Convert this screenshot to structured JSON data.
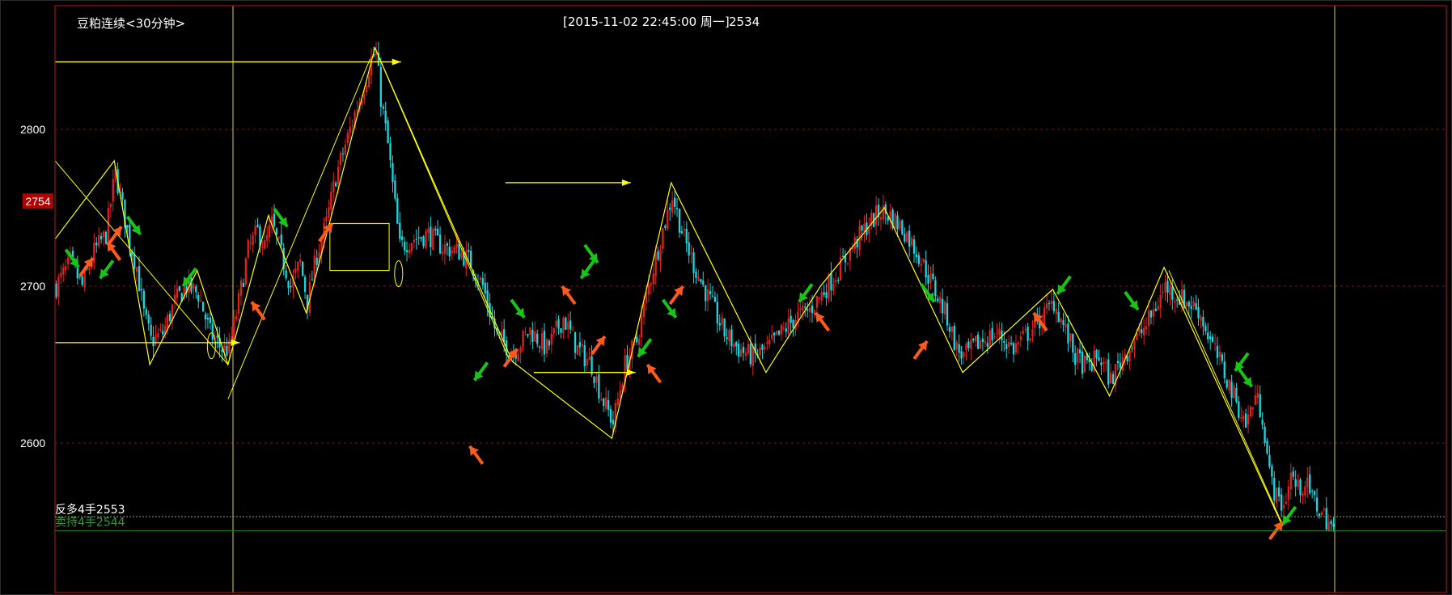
{
  "header": {
    "title": "豆粕连续<30分钟>",
    "timestamp": "[2015-11-02  22:45:00 周一]",
    "price": "2534"
  },
  "cursor_price_label": "2754",
  "positions": [
    {
      "label": "反多4手2553",
      "price": 2553,
      "color": "#ffffff"
    },
    {
      "label": "卖持4手2544",
      "price": 2544,
      "color": "#2e9e2e"
    }
  ],
  "colors": {
    "background": "#000000",
    "frame": "#a01010",
    "grid": "#7a1515",
    "up_candle": "#e02020",
    "down_candle": "#19d6e0",
    "trend_line": "#ffff00",
    "buy_arrow": "#ff5a1e",
    "sell_arrow": "#19c419",
    "price_tag": "#b00000"
  },
  "chart_data": {
    "type": "candlestick",
    "instrument": "豆粕连续",
    "interval": "30分钟",
    "y_ticks": [
      2800,
      2700,
      2600
    ],
    "ylim": [
      2520,
      2880
    ],
    "grid": true,
    "swing_path": [
      [
        0,
        2730
      ],
      [
        25,
        2780
      ],
      [
        40,
        2650
      ],
      [
        60,
        2710
      ],
      [
        73,
        2650
      ],
      [
        90,
        2745
      ],
      [
        106,
        2683
      ],
      [
        135,
        2852
      ],
      [
        193,
        2652
      ],
      [
        235,
        2603
      ],
      [
        260,
        2766
      ],
      [
        300,
        2645
      ],
      [
        323,
        2700
      ],
      [
        350,
        2750
      ],
      [
        383,
        2645
      ],
      [
        421,
        2698
      ],
      [
        445,
        2630
      ],
      [
        468,
        2712
      ],
      [
        518,
        2547
      ]
    ],
    "close_path": [
      [
        0,
        2700
      ],
      [
        6,
        2715
      ],
      [
        11,
        2700
      ],
      [
        16,
        2722
      ],
      [
        21,
        2733
      ],
      [
        25,
        2773
      ],
      [
        28,
        2750
      ],
      [
        31,
        2728
      ],
      [
        34,
        2712
      ],
      [
        37,
        2682
      ],
      [
        40,
        2665
      ],
      [
        45,
        2670
      ],
      [
        50,
        2690
      ],
      [
        55,
        2700
      ],
      [
        60,
        2695
      ],
      [
        65,
        2670
      ],
      [
        70,
        2660
      ],
      [
        73,
        2660
      ],
      [
        77,
        2690
      ],
      [
        81,
        2723
      ],
      [
        85,
        2735
      ],
      [
        88,
        2725
      ],
      [
        91,
        2740
      ],
      [
        95,
        2720
      ],
      [
        99,
        2700
      ],
      [
        103,
        2715
      ],
      [
        106,
        2690
      ],
      [
        110,
        2720
      ],
      [
        114,
        2740
      ],
      [
        118,
        2770
      ],
      [
        122,
        2790
      ],
      [
        126,
        2810
      ],
      [
        130,
        2828
      ],
      [
        133,
        2845
      ],
      [
        135,
        2848
      ],
      [
        137,
        2820
      ],
      [
        140,
        2790
      ],
      [
        145,
        2725
      ],
      [
        150,
        2730
      ],
      [
        157,
        2733
      ],
      [
        163,
        2725
      ],
      [
        170,
        2722
      ],
      [
        175,
        2715
      ],
      [
        180,
        2700
      ],
      [
        186,
        2668
      ],
      [
        193,
        2658
      ],
      [
        200,
        2672
      ],
      [
        207,
        2660
      ],
      [
        214,
        2680
      ],
      [
        220,
        2660
      ],
      [
        226,
        2650
      ],
      [
        230,
        2630
      ],
      [
        235,
        2613
      ],
      [
        240,
        2650
      ],
      [
        245,
        2665
      ],
      [
        250,
        2700
      ],
      [
        255,
        2730
      ],
      [
        260,
        2758
      ],
      [
        265,
        2730
      ],
      [
        270,
        2710
      ],
      [
        276,
        2690
      ],
      [
        282,
        2670
      ],
      [
        288,
        2660
      ],
      [
        294,
        2655
      ],
      [
        300,
        2660
      ],
      [
        306,
        2670
      ],
      [
        312,
        2680
      ],
      [
        318,
        2685
      ],
      [
        323,
        2695
      ],
      [
        330,
        2710
      ],
      [
        336,
        2725
      ],
      [
        342,
        2738
      ],
      [
        348,
        2748
      ],
      [
        352,
        2745
      ],
      [
        358,
        2735
      ],
      [
        364,
        2720
      ],
      [
        370,
        2700
      ],
      [
        376,
        2680
      ],
      [
        380,
        2660
      ],
      [
        383,
        2655
      ],
      [
        390,
        2665
      ],
      [
        397,
        2670
      ],
      [
        404,
        2660
      ],
      [
        410,
        2670
      ],
      [
        416,
        2680
      ],
      [
        421,
        2690
      ],
      [
        425,
        2675
      ],
      [
        430,
        2655
      ],
      [
        435,
        2648
      ],
      [
        440,
        2655
      ],
      [
        445,
        2640
      ],
      [
        450,
        2655
      ],
      [
        455,
        2665
      ],
      [
        460,
        2675
      ],
      [
        465,
        2690
      ],
      [
        468,
        2700
      ],
      [
        472,
        2695
      ],
      [
        477,
        2690
      ],
      [
        482,
        2685
      ],
      [
        487,
        2665
      ],
      [
        492,
        2648
      ],
      [
        497,
        2630
      ],
      [
        502,
        2612
      ],
      [
        506,
        2630
      ],
      [
        509,
        2618
      ],
      [
        512,
        2580
      ],
      [
        515,
        2565
      ],
      [
        518,
        2560
      ],
      [
        521,
        2580
      ],
      [
        524,
        2570
      ],
      [
        527,
        2575
      ],
      [
        530,
        2565
      ],
      [
        534,
        2555
      ],
      [
        537,
        2550
      ],
      [
        540,
        2540
      ]
    ],
    "horizontal_lines": [
      {
        "from": 0,
        "to": 146,
        "price": 2843
      },
      {
        "from": 0,
        "to": 78,
        "price": 2664
      },
      {
        "from": 190,
        "to": 243,
        "price": 2766
      },
      {
        "from": 202,
        "to": 245,
        "price": 2645
      }
    ],
    "consolidation_box": {
      "x_from": 116,
      "x_to": 141,
      "price_from": 2710,
      "price_to": 2740
    },
    "buy_arrow_marks": [
      [
        16,
        2718
      ],
      [
        22,
        2728
      ],
      [
        28,
        2738
      ],
      [
        83,
        2690
      ],
      [
        117,
        2740
      ],
      [
        175,
        2598
      ],
      [
        195,
        2660
      ],
      [
        214,
        2700
      ],
      [
        232,
        2668
      ],
      [
        250,
        2650
      ],
      [
        265,
        2700
      ],
      [
        321,
        2683
      ],
      [
        368,
        2665
      ],
      [
        413,
        2683
      ],
      [
        518,
        2550
      ]
    ],
    "sell_arrow_marks": [
      [
        10,
        2712
      ],
      [
        19,
        2705
      ],
      [
        36,
        2733
      ],
      [
        54,
        2700
      ],
      [
        98,
        2738
      ],
      [
        177,
        2640
      ],
      [
        198,
        2680
      ],
      [
        222,
        2705
      ],
      [
        229,
        2715
      ],
      [
        246,
        2655
      ],
      [
        262,
        2680
      ],
      [
        314,
        2690
      ],
      [
        371,
        2690
      ],
      [
        423,
        2695
      ],
      [
        457,
        2685
      ],
      [
        498,
        2646
      ],
      [
        505,
        2636
      ],
      [
        518,
        2548
      ]
    ],
    "n_candles": 540
  }
}
